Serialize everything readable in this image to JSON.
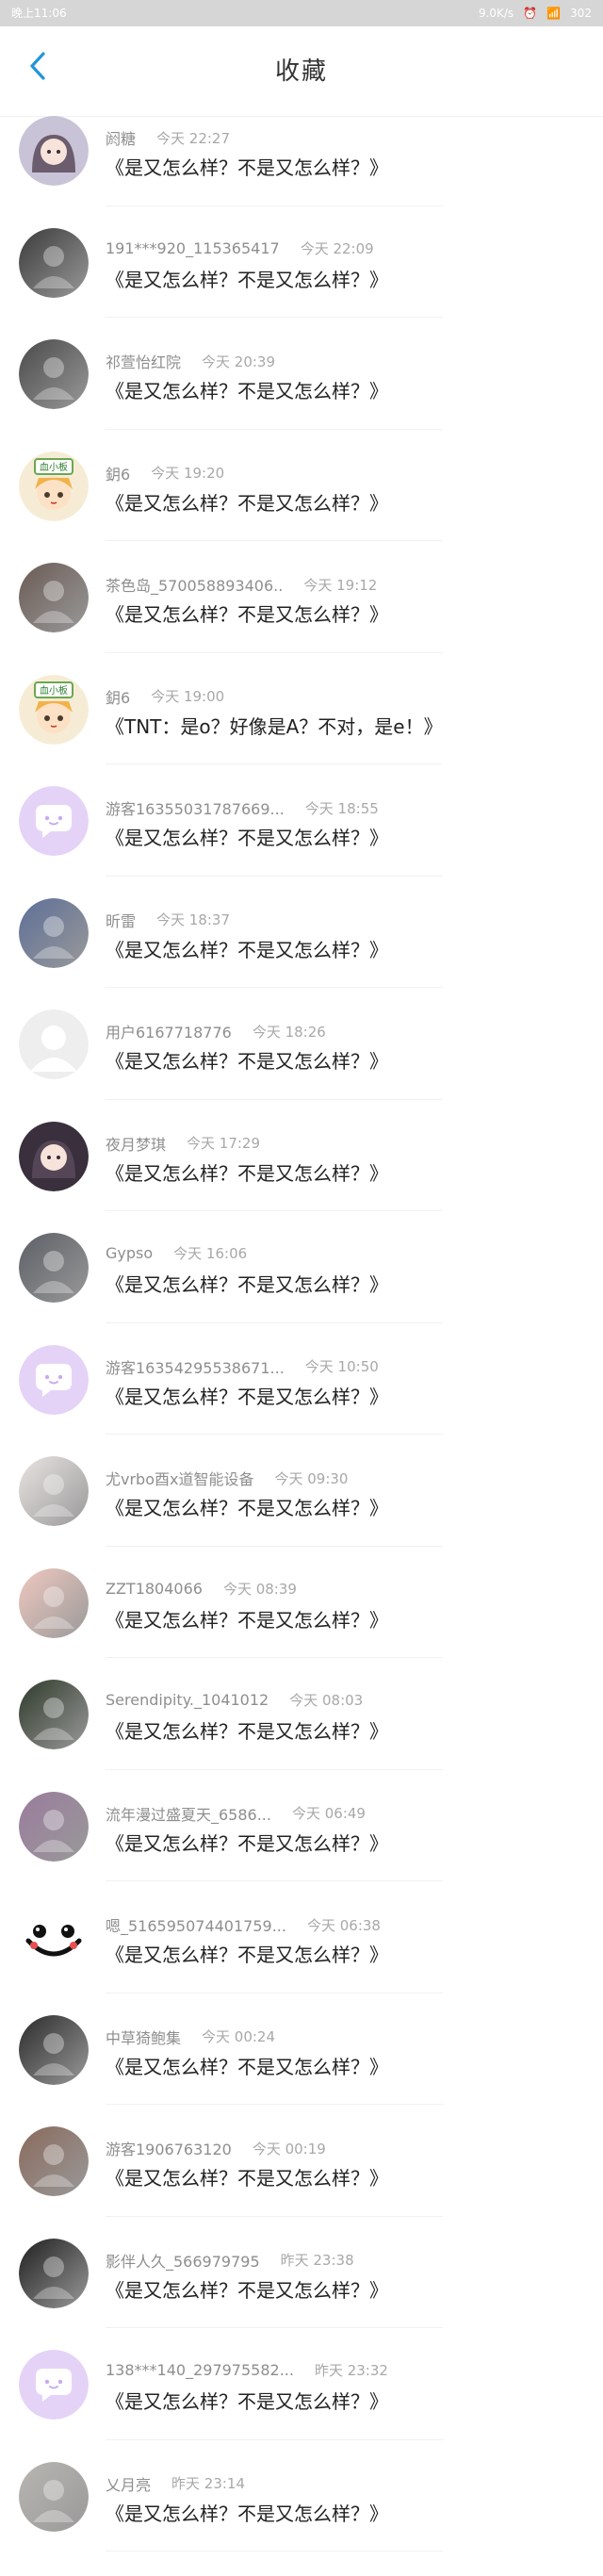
{
  "status_bar": {
    "time": "晚上11:06",
    "speed": "9.0K/s",
    "battery": "302"
  },
  "header": {
    "title": "收藏",
    "back_icon": "chevron-left-icon"
  },
  "colors": {
    "accent": "#2196d9",
    "status_bg": "#d6d6d6"
  },
  "items": [
    {
      "name": "阏糖",
      "time": "今天 22:27",
      "text": "《是又怎么样？不是又怎么样？》",
      "avatar": "anime-girl-avatar",
      "bg": "#c8c3d6"
    },
    {
      "name": "191***920_115365417",
      "time": "今天 22:09",
      "text": "《是又怎么样？不是又怎么样？》",
      "avatar": "photo-avatar",
      "bg": "#3b3b3b"
    },
    {
      "name": "祁萱怡红院",
      "time": "今天 20:39",
      "text": "《是又怎么样？不是又怎么样？》",
      "avatar": "photo-avatar",
      "bg": "#4a4a4a"
    },
    {
      "name": "鈅6",
      "time": "今天 19:20",
      "text": "《是又怎么样？不是又怎么样？》",
      "avatar": "cartoon-avatar",
      "bg": "#f3e4c4"
    },
    {
      "name": "茶色岛_570058893406..",
      "time": "今天 19:12",
      "text": "《是又怎么样？不是又怎么样？》",
      "avatar": "photo-avatar",
      "bg": "#6b5b55"
    },
    {
      "name": "鈅6",
      "time": "今天 19:00",
      "text": "《TNT：是o？好像是A？不对，是e！》",
      "avatar": "cartoon-avatar",
      "bg": "#f3e4c4"
    },
    {
      "name": "游客16355031787669...",
      "time": "今天 18:55",
      "text": "《是又怎么样？不是又怎么样？》",
      "avatar": "chat-bubble-avatar",
      "bg": "#e4d3f7"
    },
    {
      "name": "昕雷",
      "time": "今天 18:37",
      "text": "《是又怎么样？不是又怎么样？》",
      "avatar": "photo-avatar",
      "bg": "#5d6f98"
    },
    {
      "name": "用户6167718776",
      "time": "今天 18:26",
      "text": "《是又怎么样？不是又怎么样？》",
      "avatar": "default-user-avatar",
      "bg": "#ededed"
    },
    {
      "name": "夜月梦琪",
      "time": "今天 17:29",
      "text": "《是又怎么样？不是又怎么样？》",
      "avatar": "anime-girl-avatar",
      "bg": "#3a2f3c"
    },
    {
      "name": "Gypso",
      "time": "今天 16:06",
      "text": "《是又怎么样？不是又怎么样？》",
      "avatar": "photo-avatar",
      "bg": "#5c5f66"
    },
    {
      "name": "游客16354295538671...",
      "time": "今天 10:50",
      "text": "《是又怎么样？不是又怎么样？》",
      "avatar": "chat-bubble-avatar",
      "bg": "#e4d3f7"
    },
    {
      "name": "尤vrbo酉x道智能设备",
      "time": "今天 09:30",
      "text": "《是又怎么样？不是又怎么样？》",
      "avatar": "photo-avatar",
      "bg": "#e9e4e2"
    },
    {
      "name": "ZZT1804066",
      "time": "今天 08:39",
      "text": "《是又怎么样？不是又怎么样？》",
      "avatar": "photo-avatar",
      "bg": "#f0c9c0"
    },
    {
      "name": "Serendipity._1041012",
      "time": "今天 08:03",
      "text": "《是又怎么样？不是又怎么样？》",
      "avatar": "photo-avatar",
      "bg": "#2f3a2b"
    },
    {
      "name": "流年漫过盛夏天_6586...",
      "time": "今天 06:49",
      "text": "《是又怎么样？不是又怎么样？》",
      "avatar": "photo-avatar",
      "bg": "#9a7c9d"
    },
    {
      "name": "嗯_516595074401759...",
      "time": "今天 06:38",
      "text": "《是又怎么样？不是又怎么样？》",
      "avatar": "smiley-avatar",
      "bg": "#ffffff"
    },
    {
      "name": "中草猗鲍集",
      "time": "今天 00:24",
      "text": "《是又怎么样？不是又怎么样？》",
      "avatar": "photo-avatar",
      "bg": "#2b2b2b"
    },
    {
      "name": "游客1906763120",
      "time": "今天 00:19",
      "text": "《是又怎么样？不是又怎么样？》",
      "avatar": "photo-avatar",
      "bg": "#8a6a5c"
    },
    {
      "name": "影伴人久_566979795",
      "time": "昨天 23:38",
      "text": "《是又怎么样？不是又怎么样？》",
      "avatar": "photo-avatar",
      "bg": "#1f1f1f"
    },
    {
      "name": "138***140_297975582...",
      "time": "昨天 23:32",
      "text": "《是又怎么样？不是又怎么样？》",
      "avatar": "chat-bubble-avatar",
      "bg": "#e4d3f7"
    },
    {
      "name": "乂月亮",
      "time": "昨天 23:14",
      "text": "《是又怎么样？不是又怎么样？》",
      "avatar": "photo-avatar",
      "bg": "#b9b6b2"
    }
  ]
}
